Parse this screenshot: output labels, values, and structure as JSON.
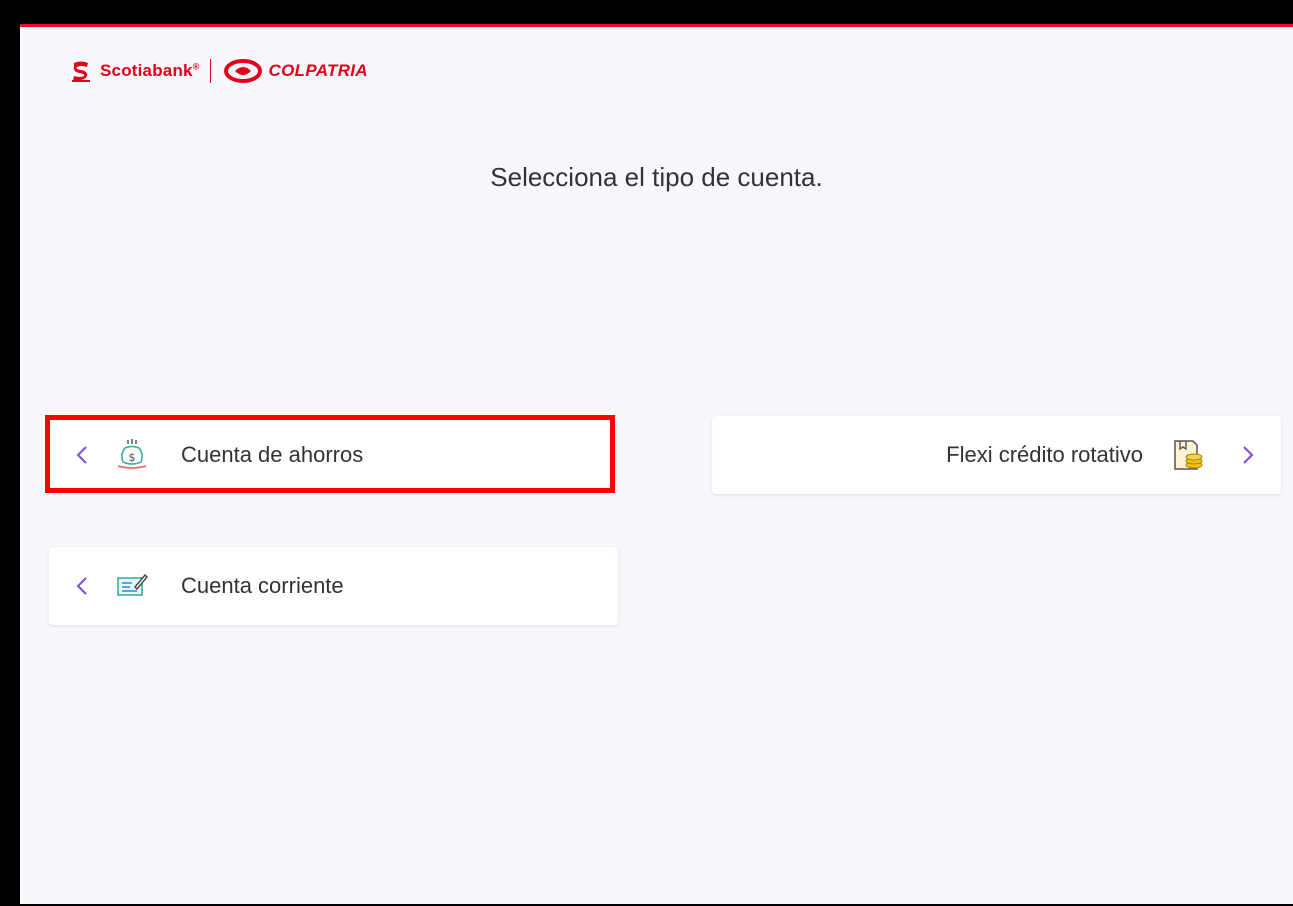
{
  "header": {
    "brand_primary": "Scotiabank",
    "brand_primary_mark": "®",
    "brand_secondary": "COLPATRIA",
    "accent_color": "#e3001b"
  },
  "page": {
    "title": "Selecciona el tipo de cuenta."
  },
  "options": [
    {
      "label": "Cuenta de ahorros",
      "icon": "savings-money-icon",
      "arrow": "chevron-left-icon"
    },
    {
      "label": "Cuenta corriente",
      "icon": "checkbook-icon",
      "arrow": "chevron-left-icon"
    },
    {
      "label": "Flexi crédito rotativo",
      "icon": "credit-folder-coins-icon",
      "arrow": "chevron-right-icon"
    }
  ],
  "colors": {
    "chevron": "#7b4fd6",
    "highlight": "#ff0000",
    "background": "#f7f8fb"
  }
}
